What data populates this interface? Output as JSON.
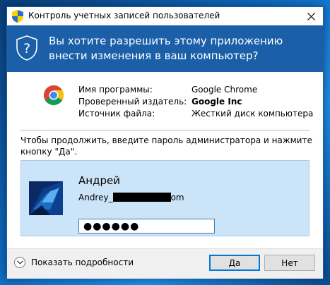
{
  "window": {
    "title": "Контроль учетных записей пользователей",
    "shield_icon": "uac-shield-icon",
    "close_icon": "close-icon"
  },
  "banner": {
    "question": "Вы хотите разрешить этому приложению внести изменения в ваш компьютер?",
    "background": "#1a5fa8"
  },
  "program_info": {
    "icon": "chrome-icon",
    "rows": [
      {
        "label": "Имя программы:",
        "value": "Google Chrome",
        "bold": false
      },
      {
        "label": "Проверенный издатель:",
        "value": "Google Inc",
        "bold": true
      },
      {
        "label": "Источник файла:",
        "value": "Жесткий диск компьютера",
        "bold": false
      }
    ]
  },
  "prompt": "Чтобы продолжить, введите пароль администратора и нажмите кнопку \"Да\".",
  "credentials": {
    "user_name": "Андрей",
    "login_prefix": "Andrey_",
    "login_suffix": "om",
    "password_mask": "●●●●●●",
    "panel_color": "#cce4f7"
  },
  "footer": {
    "details_label": "Показать подробности",
    "yes_label": "Да",
    "no_label": "Нет",
    "accent": "#0078d7"
  }
}
